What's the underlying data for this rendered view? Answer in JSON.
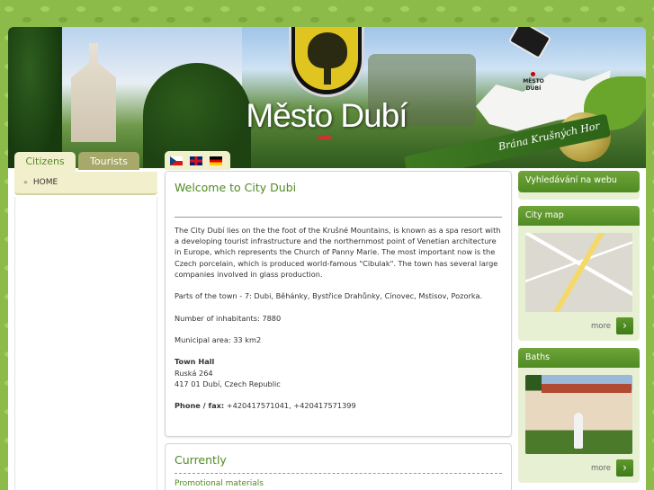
{
  "header": {
    "site_title": "Město Dubí",
    "ribbon_text": "Brána Krušných Hor",
    "map_label": "MĚSTO DUBÍ"
  },
  "tabs": [
    {
      "label": "Citizens",
      "active": true
    },
    {
      "label": "Tourists",
      "active": false
    }
  ],
  "languages": [
    "czech-flag",
    "english-flag",
    "german-flag"
  ],
  "left_menu": {
    "items": [
      {
        "label": "HOME",
        "icon": "double-chevron-right-icon"
      }
    ]
  },
  "main": {
    "title": "Welcome to City Dubi",
    "paragraph1": "The City Dubí lies on the the foot of the Krušné Mountains, is known as a spa resort with a developing tourist infrastructure and the northernmost point of Venetian architecture in Europe, which represents the Church of Panny Marie. The most important now is the Czech porcelain, which is produced world-famous \"Cibulak\". The town has several large companies involved in glass production.",
    "paragraph2": "Parts of the town - 7: Dubi, Běhánky, Bystřice Drahůnky, Cínovec, Mstisov, Pozorka.",
    "paragraph3": "Number of inhabitants: 7880",
    "paragraph4": "Municipal area: 33 km2",
    "town_hall_label": "Town Hall",
    "address_line1": "Ruská 264",
    "address_line2": "417 01 Dubí, Czech Republic",
    "phone_label": "Phone / fax:",
    "phone_value": " +420417571041, +420417571399"
  },
  "currently": {
    "title": "Currently",
    "link": "Promotional materials"
  },
  "sidebar": {
    "search_title": "Vyhledávání na webu",
    "map_title": "City map",
    "map_more": "more",
    "baths_title": "Baths",
    "baths_more": "more"
  },
  "colors": {
    "accent": "#4f8a22",
    "tab_active_bg": "#f2f0cc",
    "tab_inactive_bg": "#a6a96a",
    "background": "#8cbb4a"
  }
}
